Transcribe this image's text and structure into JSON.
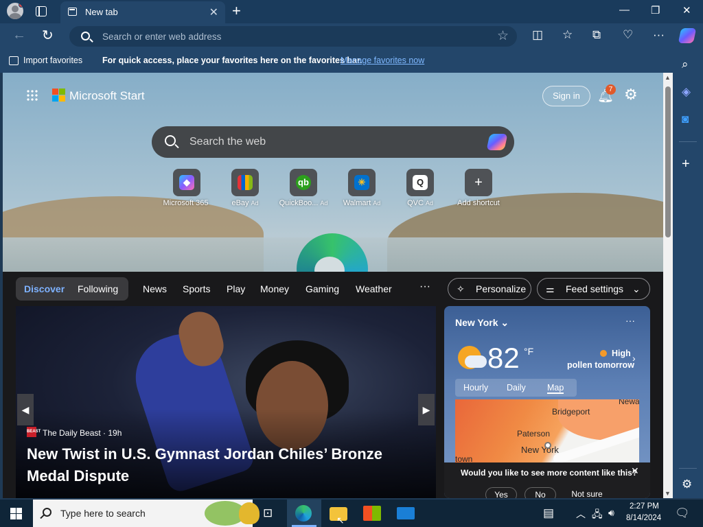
{
  "browser": {
    "tab_title": "New tab",
    "address_placeholder": "Search or enter web address"
  },
  "favorites_bar": {
    "import_label": "Import favorites",
    "message": "For quick access, place your favorites here on the favorites bar.",
    "manage_link": "Manage favorites now"
  },
  "start_page": {
    "brand": "Microsoft Start",
    "sign_in": "Sign in",
    "notification_count": "7",
    "search_placeholder": "Search the web",
    "shortcuts": [
      {
        "label": "Microsoft 365",
        "ad": ""
      },
      {
        "label": "eBay",
        "ad": "Ad"
      },
      {
        "label": "QuickBoo...",
        "ad": "Ad"
      },
      {
        "label": "Walmart",
        "ad": "Ad"
      },
      {
        "label": "QVC",
        "ad": "Ad"
      },
      {
        "label": "Add shortcut",
        "ad": ""
      }
    ]
  },
  "feed": {
    "pills": [
      "Discover",
      "Following"
    ],
    "nav": [
      "News",
      "Sports",
      "Play",
      "Money",
      "Gaming",
      "Weather"
    ],
    "more": "···",
    "personalize": "Personalize",
    "feed_settings": "Feed settings",
    "hero": {
      "source": "The Daily Beast · 19h",
      "source_icon_text": "BEAST",
      "headline": "New Twist in U.S. Gymnast Jordan Chiles’ Bronze Medal Dispute"
    }
  },
  "weather": {
    "city": "New York",
    "temperature": "82",
    "unit": "°F",
    "pollen_line1": "High",
    "pollen_line2": "pollen tomorrow",
    "tabs": [
      "Hourly",
      "Daily",
      "Map"
    ],
    "map_labels": [
      "Bridgeport",
      "Paterson",
      "New York",
      "Newa",
      "town"
    ],
    "survey_question": "Would you like to see more content like this?",
    "survey_options": [
      "Yes",
      "No",
      "Not sure"
    ]
  },
  "taskbar": {
    "search_placeholder": "Type here to search",
    "time": "2:27 PM",
    "date": "8/14/2024"
  },
  "colors": {
    "chrome": "#23466a",
    "accent_link": "#7fb8ff",
    "feed_bg": "#19191b",
    "taskbar": "#0f2538"
  }
}
